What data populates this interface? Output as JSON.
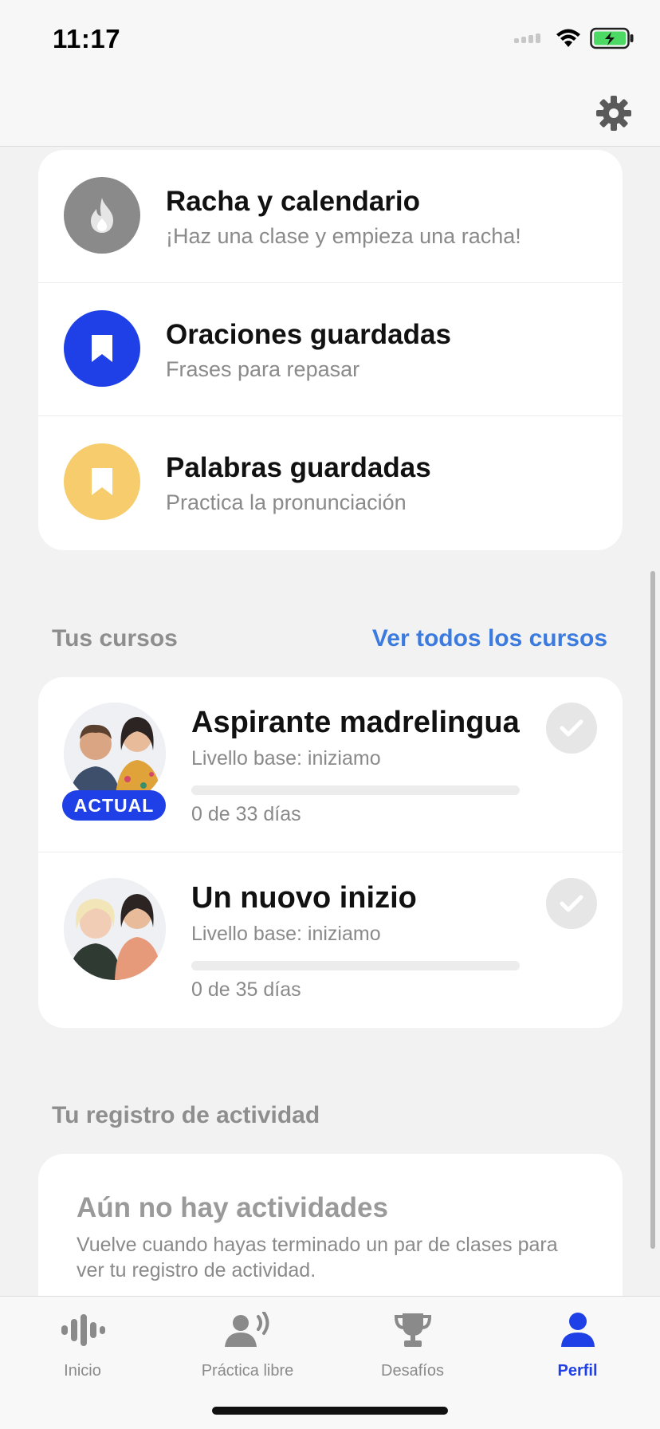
{
  "status_bar": {
    "time": "11:17",
    "icons": [
      "signal-icon",
      "wifi-icon",
      "battery-charging-icon"
    ]
  },
  "header": {
    "settings_icon": "gear-icon"
  },
  "menu": {
    "items": [
      {
        "title": "Racha y calendario",
        "subtitle": "¡Haz una clase y empieza una racha!",
        "icon": "flame-icon",
        "color": "#8a8a8a"
      },
      {
        "title": "Oraciones guardadas",
        "subtitle": "Frases para repasar",
        "icon": "bookmark-icon",
        "color": "#1f40e6"
      },
      {
        "title": "Palabras guardadas",
        "subtitle": "Practica la pronunciación",
        "icon": "bookmark-icon",
        "color": "#f6cc6c"
      }
    ]
  },
  "courses": {
    "header": "Tus cursos",
    "see_all": "Ver todos los cursos",
    "items": [
      {
        "title": "Aspirante madrelingua",
        "level": "Livello base: iniziamo",
        "progress_text": "0 de 33 días",
        "progress": 0,
        "badge": "ACTUAL"
      },
      {
        "title": "Un nuovo inizio",
        "level": "Livello base: iniziamo",
        "progress_text": "0 de 35 días",
        "progress": 0
      }
    ]
  },
  "activity": {
    "header": "Tu registro de actividad",
    "empty_title": "Aún no hay actividades",
    "empty_desc": "Vuelve cuando hayas terminado un par de clases para ver tu registro de actividad."
  },
  "tab_bar": {
    "tabs": [
      {
        "label": "Inicio",
        "icon": "waveform-icon",
        "active": false
      },
      {
        "label": "Práctica libre",
        "icon": "person-speaking-icon",
        "active": false
      },
      {
        "label": "Desafíos",
        "icon": "trophy-icon",
        "active": false
      },
      {
        "label": "Perfil",
        "icon": "person-icon",
        "active": true
      }
    ],
    "active_color": "#1f40e6"
  }
}
